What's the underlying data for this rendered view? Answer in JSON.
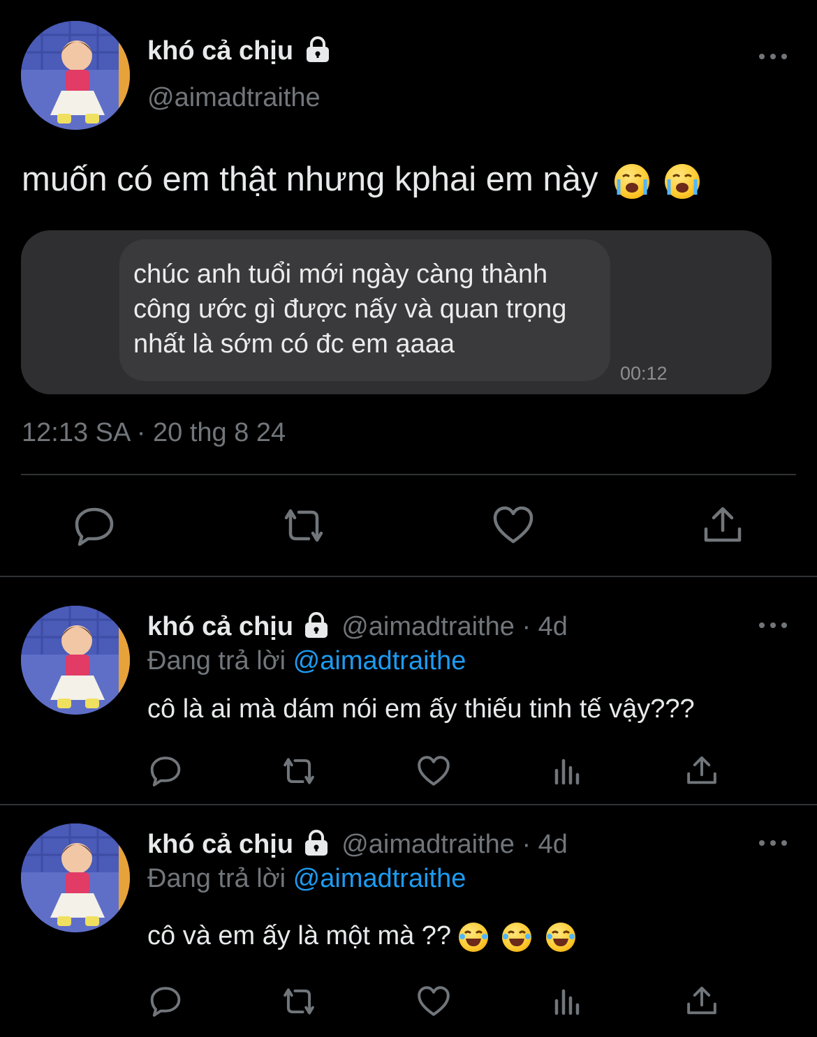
{
  "main_tweet": {
    "display_name": "khó cả chịu",
    "handle": "@aimadtraithe",
    "text": "muốn có em thật nhưng kphai em này",
    "text_emojis": [
      "loudly-crying-face",
      "loudly-crying-face"
    ],
    "embedded_message": {
      "text": "chúc anh tuổi mới ngày càng thành công ước gì được nấy và quan trọng nhất là sớm có đc em ạaaa",
      "time": "00:12"
    },
    "timestamp": "12:13 SA · 20 thg 8 24",
    "actions": [
      "reply-icon",
      "retweet-icon",
      "like-icon",
      "share-icon"
    ]
  },
  "replies": [
    {
      "display_name": "khó cả chịu",
      "handle": "@aimadtraithe",
      "age": "· 4d",
      "replying_prefix": "Đang trả lời",
      "replying_to": "@aimadtraithe",
      "text": "cô là ai mà dám nói em ấy thiếu tinh tế vậy???",
      "emojis": []
    },
    {
      "display_name": "khó cả chịu",
      "handle": "@aimadtraithe",
      "age": "· 4d",
      "replying_prefix": "Đang trả lời",
      "replying_to": "@aimadtraithe",
      "text": "cô và em ấy là một mà ??",
      "emojis": [
        "face-with-tears-of-joy",
        "face-with-tears-of-joy",
        "face-with-tears-of-joy"
      ]
    }
  ],
  "colors": {
    "background": "#000000",
    "text": "#e7e9ea",
    "muted": "#71767b",
    "link": "#1d9bf0",
    "bubble_outer": "#2f2f31",
    "bubble_inner": "#3a3a3c"
  }
}
